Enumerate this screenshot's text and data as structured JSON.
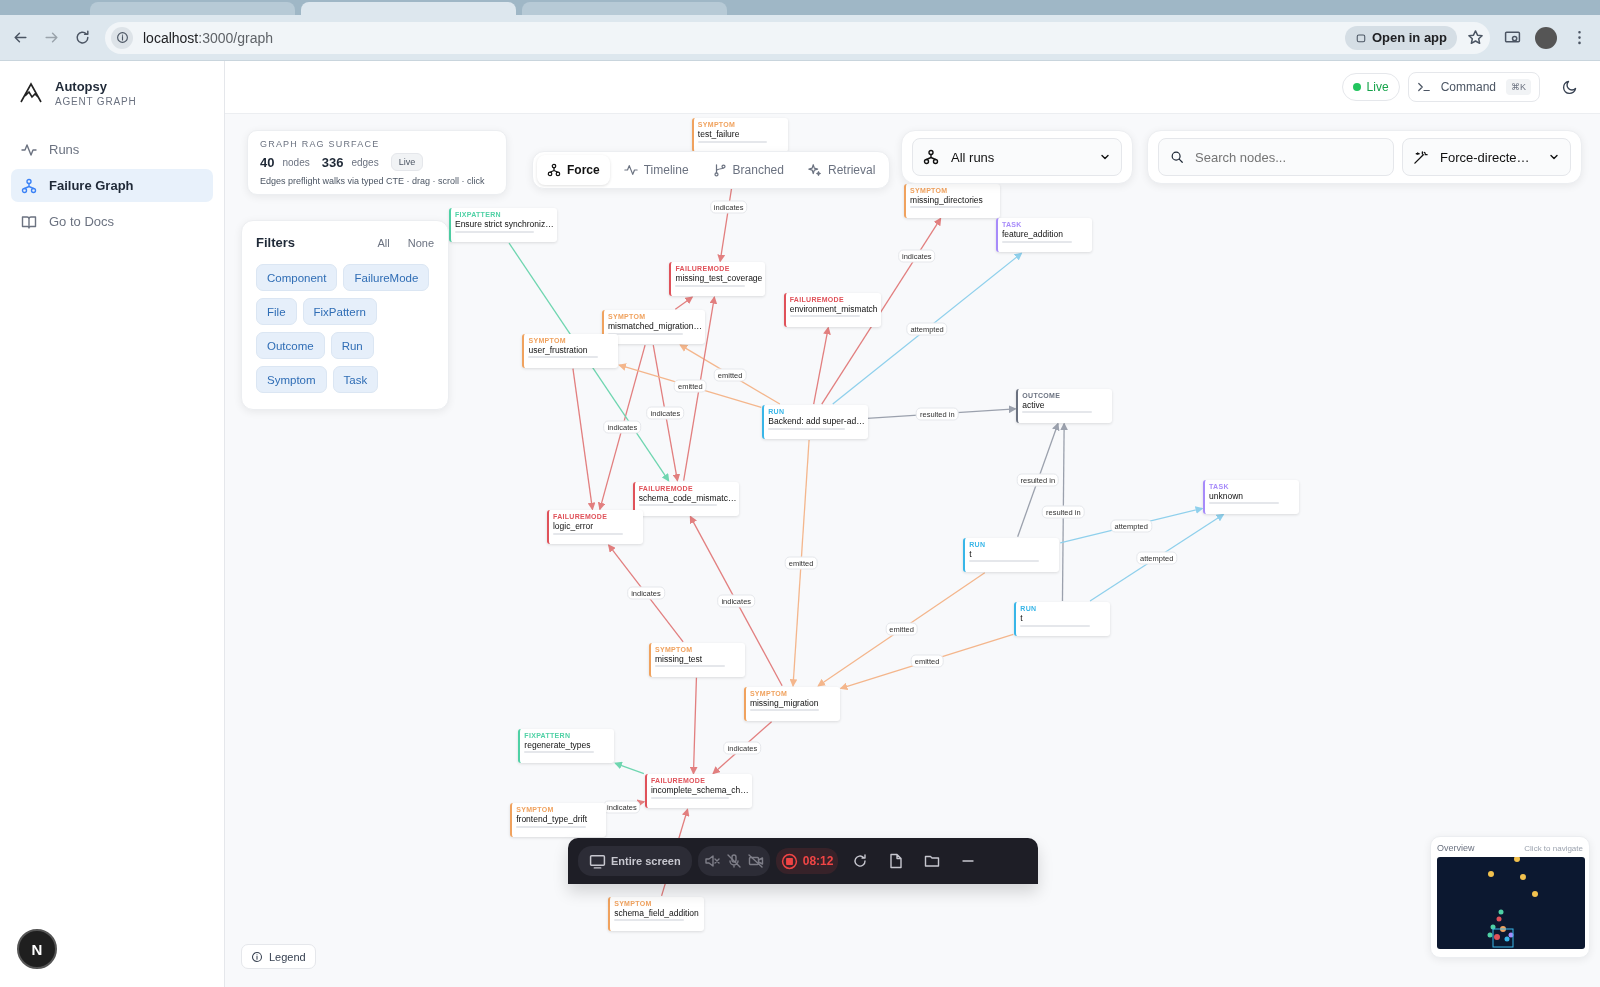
{
  "browser": {
    "tabs": [
      {
        "selected": false
      },
      {
        "selected": true
      },
      {
        "selected": false
      }
    ],
    "url_host": "localhost",
    "url_path": ":3000/graph",
    "open_in_app": "Open in app"
  },
  "sidebar": {
    "brand": "Autopsy",
    "subtitle": "AGENT GRAPH",
    "items": [
      {
        "label": "Runs",
        "selected": false
      },
      {
        "label": "Failure Graph",
        "selected": true
      },
      {
        "label": "Go to Docs",
        "selected": false
      }
    ],
    "dev_badge": "N"
  },
  "header": {
    "status": "Live",
    "command": "Command",
    "shortcut": "⌘K"
  },
  "surface": {
    "title": "GRAPH RAG SURFACE",
    "node_count": "40",
    "node_label": "nodes",
    "edge_count": "336",
    "edge_label": "edges",
    "badge": "Live",
    "caption": "Edges preflight walks via typed CTE · drag · scroll · click"
  },
  "views": [
    {
      "label": "Force",
      "selected": true
    },
    {
      "label": "Timeline",
      "selected": false
    },
    {
      "label": "Branched",
      "selected": false
    },
    {
      "label": "Retrieval",
      "selected": false
    }
  ],
  "run_select": {
    "value": "All runs"
  },
  "search": {
    "placeholder": "Search nodes..."
  },
  "layout_select": {
    "value": "Force-directe…"
  },
  "filters": {
    "title": "Filters",
    "all": "All",
    "none": "None",
    "chips": [
      {
        "label": "Component",
        "selected": true
      },
      {
        "label": "FailureMode",
        "selected": true
      },
      {
        "label": "File",
        "selected": true
      },
      {
        "label": "FixPattern",
        "selected": true
      },
      {
        "label": "Outcome",
        "selected": true
      },
      {
        "label": "Run",
        "selected": true
      },
      {
        "label": "Symptom",
        "selected": true
      },
      {
        "label": "Task",
        "selected": true
      }
    ]
  },
  "nodes": [
    {
      "kind": "symptom",
      "type": "SYMPTOM",
      "title": "test_failure"
    },
    {
      "kind": "fixpattern",
      "type": "FIXPATTERN",
      "title": "Ensure strict synchroniz…"
    },
    {
      "kind": "failuremode",
      "type": "FAILUREMODE",
      "title": "missing_test_coverage"
    },
    {
      "kind": "symptom",
      "type": "SYMPTOM",
      "title": "missing_directories"
    },
    {
      "kind": "task",
      "type": "TASK",
      "title": "feature_addition"
    },
    {
      "kind": "failuremode",
      "type": "FAILUREMODE",
      "title": "environment_mismatch"
    },
    {
      "kind": "symptom",
      "type": "SYMPTOM",
      "title": "mismatched_migration…"
    },
    {
      "kind": "symptom",
      "type": "SYMPTOM",
      "title": "user_frustration"
    },
    {
      "kind": "run",
      "type": "RUN",
      "title": "Backend: add super-ad…"
    },
    {
      "kind": "outcome",
      "type": "OUTCOME",
      "title": "active"
    },
    {
      "kind": "failuremode",
      "type": "FAILUREMODE",
      "title": "schema_code_mismatc…"
    },
    {
      "kind": "failuremode",
      "type": "FAILUREMODE",
      "title": "logic_error"
    },
    {
      "kind": "task",
      "type": "TASK",
      "title": "unknown"
    },
    {
      "kind": "run",
      "type": "RUN",
      "title": "t"
    },
    {
      "kind": "run",
      "type": "RUN",
      "title": "t"
    },
    {
      "kind": "symptom",
      "type": "SYMPTOM",
      "title": "missing_test"
    },
    {
      "kind": "symptom",
      "type": "SYMPTOM",
      "title": "missing_migration"
    },
    {
      "kind": "fixpattern",
      "type": "FIXPATTERN",
      "title": "regenerate_types"
    },
    {
      "kind": "failuremode",
      "type": "FAILUREMODE",
      "title": "incomplete_schema_ch…"
    },
    {
      "kind": "symptom",
      "type": "SYMPTOM",
      "title": "frontend_type_drift"
    },
    {
      "kind": "symptom",
      "type": "SYMPTOM",
      "title": "schema_field_addition"
    }
  ],
  "edges": [
    {
      "kind": "indicates",
      "label": "indicates"
    },
    {
      "kind": "indicates",
      "label": "indicates"
    },
    {
      "kind": "indicates",
      "label": "indicates"
    },
    {
      "kind": "indicates"
    },
    {
      "kind": "indicates"
    },
    {
      "kind": "emitted",
      "label": "emitted"
    },
    {
      "kind": "emitted",
      "label": "emitted"
    },
    {
      "kind": "fixes"
    },
    {
      "kind": "indicates"
    },
    {
      "kind": "indicates"
    },
    {
      "kind": "indicates",
      "label": "indicates"
    },
    {
      "kind": "attempted",
      "label": "attempted"
    },
    {
      "kind": "resulted_in",
      "label": "resulted in"
    },
    {
      "kind": "emitted",
      "label": "emitted"
    },
    {
      "kind": "resulted_in",
      "label": "resulted in"
    },
    {
      "kind": "resulted_in",
      "label": "resulted in"
    },
    {
      "kind": "attempted",
      "label": "attempted"
    },
    {
      "kind": "attempted",
      "label": "attempted"
    },
    {
      "kind": "emitted",
      "label": "emitted"
    },
    {
      "kind": "emitted",
      "label": "emitted"
    },
    {
      "kind": "indicates",
      "label": "indicates"
    },
    {
      "kind": "indicates",
      "label": "indicates"
    },
    {
      "kind": "indicates"
    },
    {
      "kind": "indicates",
      "label": "indicates"
    },
    {
      "kind": "fixes"
    },
    {
      "kind": "indicates",
      "label": "indicates"
    },
    {
      "kind": "indicates"
    }
  ],
  "legend": {
    "label": "Legend"
  },
  "overview": {
    "title": "Overview",
    "hint": "Click to navigate"
  },
  "recorder": {
    "source": "Entire screen",
    "time": "08:12"
  }
}
